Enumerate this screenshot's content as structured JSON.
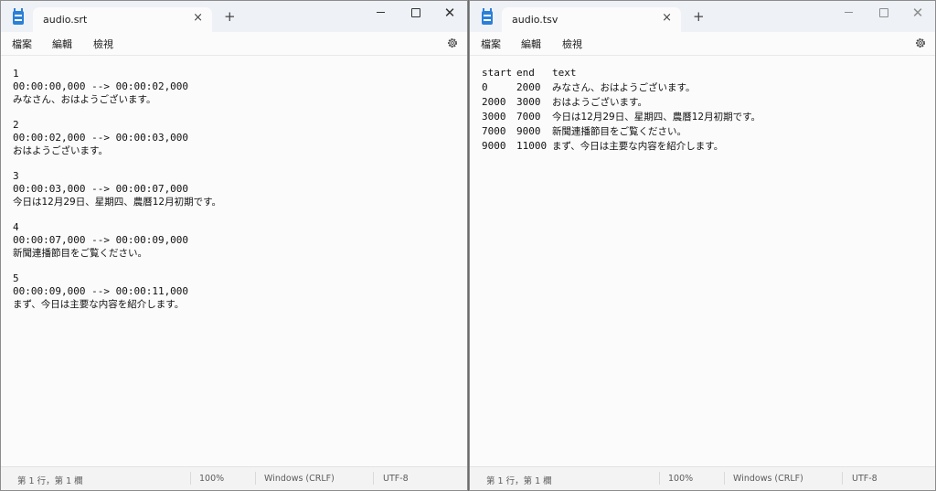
{
  "left_window": {
    "tab_title": "audio.srt",
    "menu": [
      "檔案",
      "編輯",
      "檢視"
    ],
    "lines": [
      "1",
      "00:00:00,000 --> 00:00:02,000",
      "みなさん、おはようございます。",
      "",
      "2",
      "00:00:02,000 --> 00:00:03,000",
      "おはようございます。",
      "",
      "3",
      "00:00:03,000 --> 00:00:07,000",
      "今日は12月29日、星期四、農曆12月初期です。",
      "",
      "4",
      "00:00:07,000 --> 00:00:09,000",
      "新聞連播節目をご覧ください。",
      "",
      "5",
      "00:00:09,000 --> 00:00:11,000",
      "まず、今日は主要な内容を紹介します。"
    ],
    "status": {
      "position": "第 1 行，第 1 欄",
      "zoom": "100%",
      "line_ending": "Windows (CRLF)",
      "encoding": "UTF-8"
    }
  },
  "right_window": {
    "tab_title": "audio.tsv",
    "menu": [
      "檔案",
      "編輯",
      "檢視"
    ],
    "header": [
      "start",
      "end",
      "text"
    ],
    "rows": [
      [
        "0",
        "2000",
        "みなさん、おはようございます。"
      ],
      [
        "2000",
        "3000",
        "おはようございます。"
      ],
      [
        "3000",
        "7000",
        "今日は12月29日、星期四、農曆12月初期です。"
      ],
      [
        "7000",
        "9000",
        "新聞連播節目をご覧ください。"
      ],
      [
        "9000",
        "11000",
        "まず、今日は主要な内容を紹介します。"
      ]
    ],
    "status": {
      "position": "第 1 行，第 1 欄",
      "zoom": "100%",
      "line_ending": "Windows (CRLF)",
      "encoding": "UTF-8"
    }
  },
  "icons": {
    "app": "notepad-icon",
    "close_tab": "×",
    "new_tab": "+",
    "minimize": "minimize-icon",
    "maximize": "maximize-icon",
    "close_window": "✕",
    "settings": "gear-icon"
  }
}
